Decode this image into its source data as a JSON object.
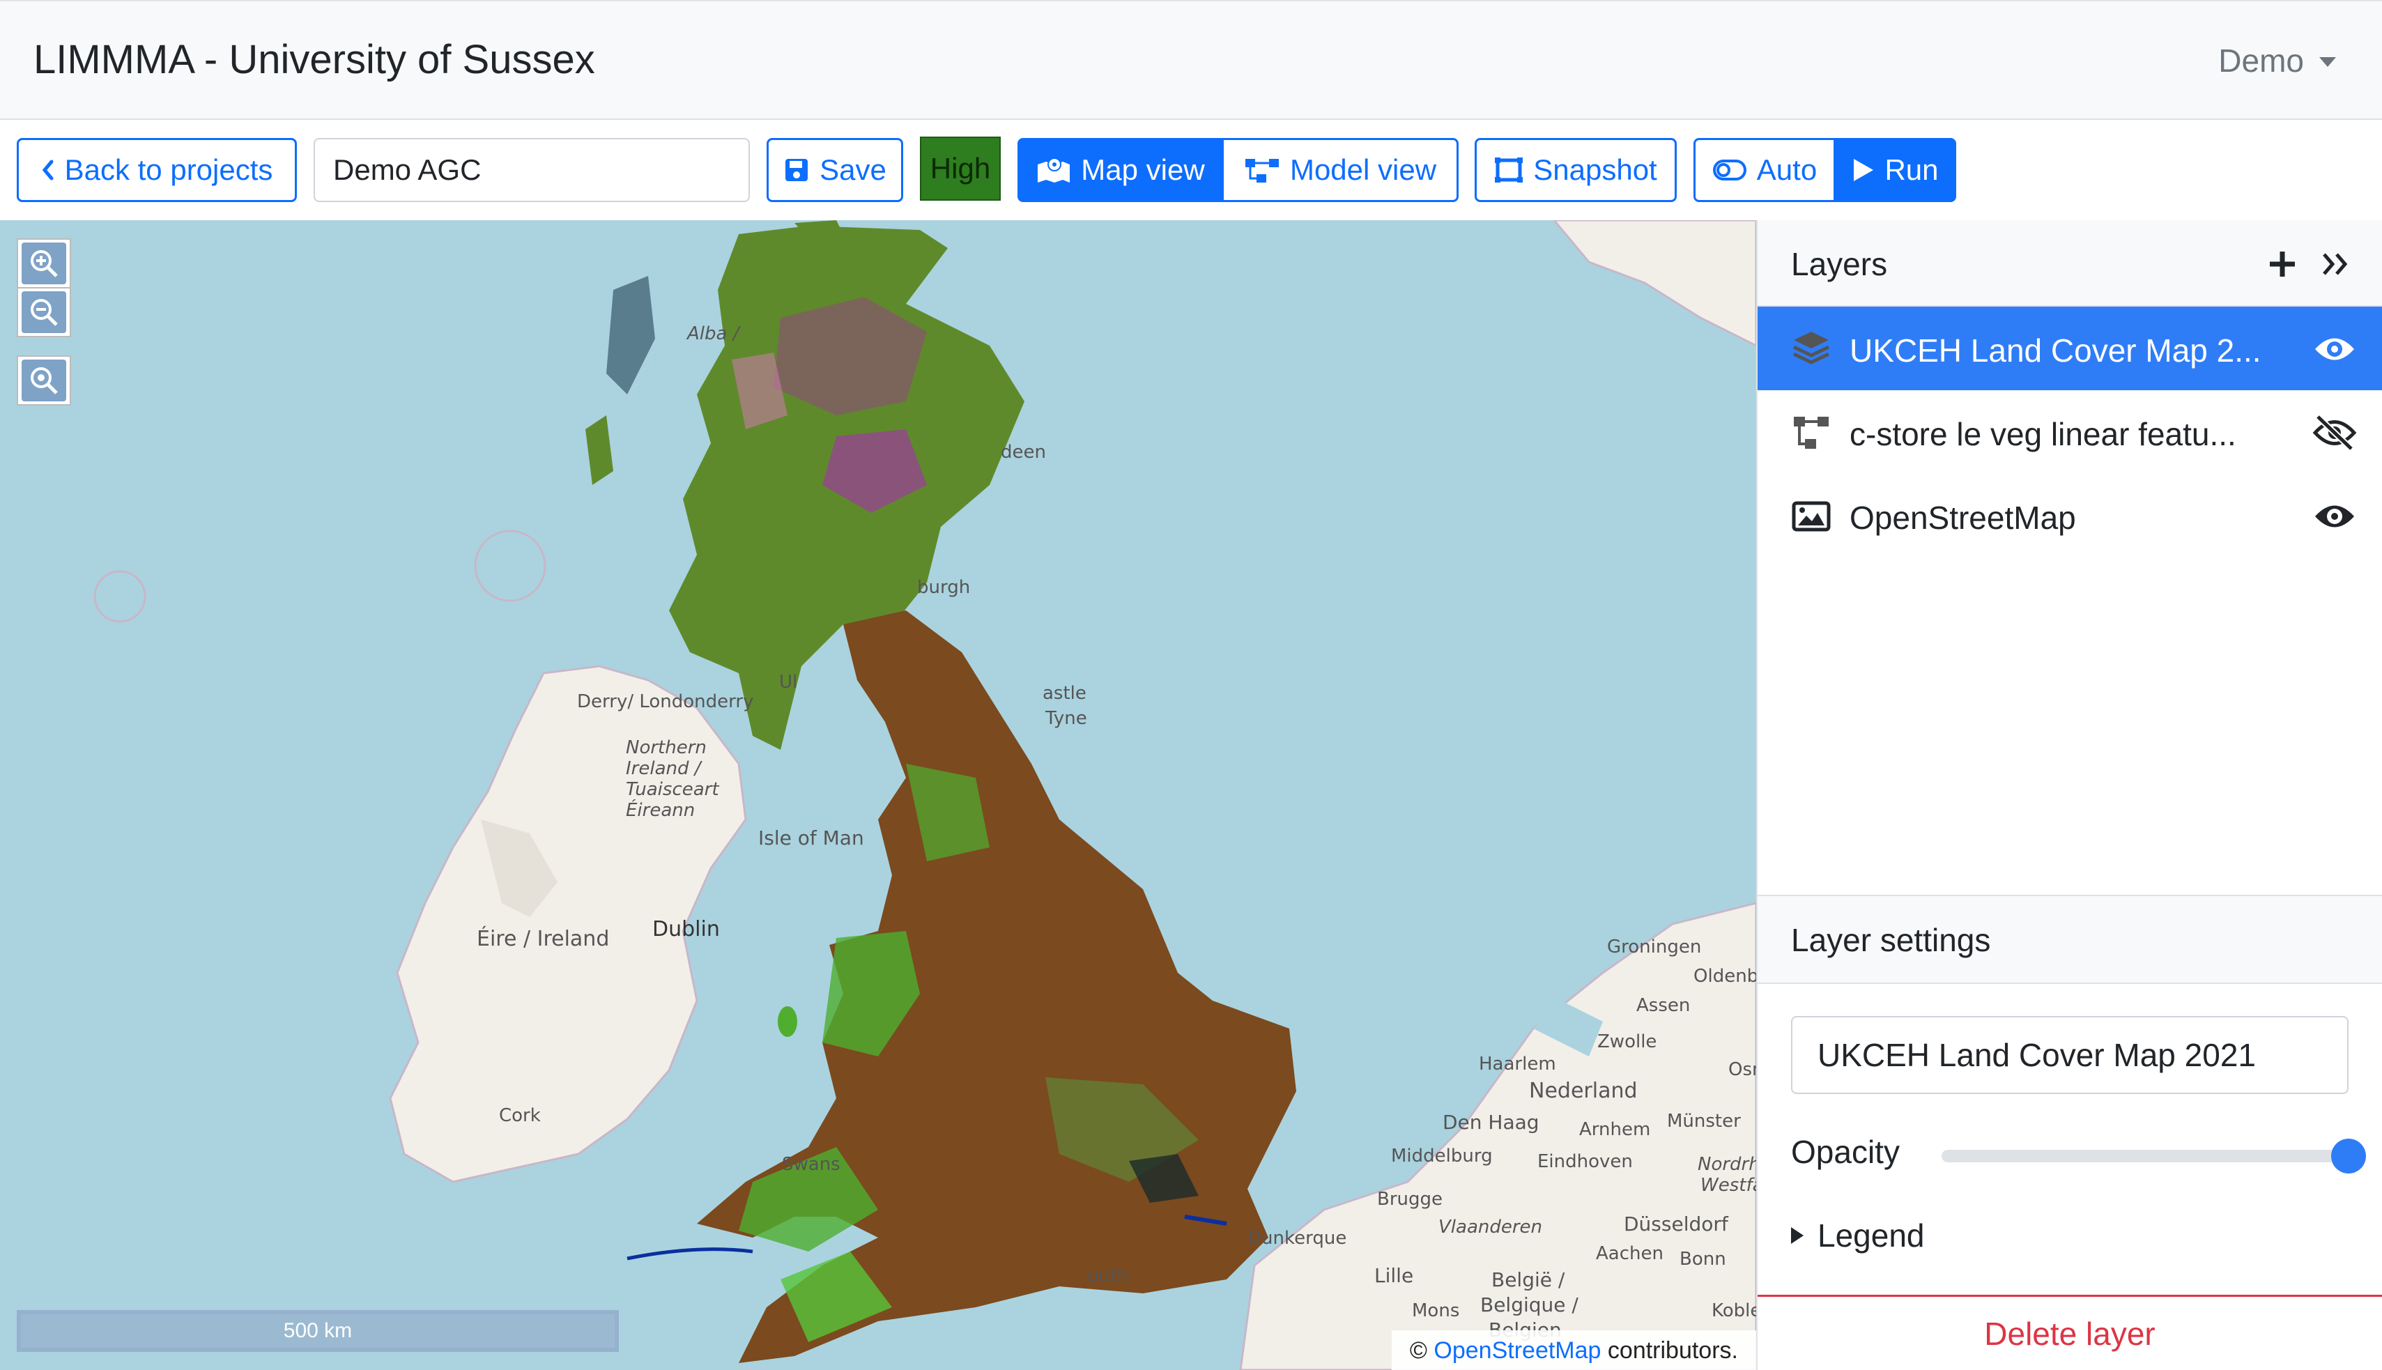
{
  "app": {
    "title": "LIMMMA - University of Sussex",
    "user_menu": "Demo"
  },
  "toolbar": {
    "back_label": "Back to projects",
    "project_name": "Demo AGC",
    "save_label": "Save",
    "quality_badge": "High",
    "map_view_label": "Map view",
    "model_view_label": "Model view",
    "snapshot_label": "Snapshot",
    "auto_label": "Auto",
    "run_label": "Run"
  },
  "map": {
    "scale_label": "500 km",
    "attribution_prefix": "©",
    "attribution_link": "OpenStreetMap",
    "attribution_suffix": "contributors.",
    "labels": {
      "derry": "Derry/ Londonderry",
      "ni": "Northern Ireland / Tuaisceart Éireann",
      "isle_of_man": "Isle of Man",
      "eire": "Éire / Ireland",
      "dublin": "Dublin",
      "cork": "Cork",
      "alba": "Alba /",
      "deen": "deen",
      "burgh": "burgh",
      "astle": "astle",
      "tyne": "Tyne",
      "groningen": "Groningen",
      "oldenbu": "Oldenbu",
      "assen": "Assen",
      "zwolle": "Zwolle",
      "haarlem": "Haarlem",
      "nederland": "Nederland",
      "den_haag": "Den Haag",
      "arnhem": "Arnhem",
      "munster": "Münster",
      "middelburg": "Middelburg",
      "eindhoven": "Eindhoven",
      "nordrhe": "Nordrhe",
      "westfal": "Westfal",
      "brugge": "Brugge",
      "vlaanderen": "Vlaanderen",
      "dusseldorf": "Düsseldorf",
      "dunkerque": "Dunkerque",
      "aachen": "Aachen",
      "bonn": "Bonn",
      "lille": "Lille",
      "belgie": "België /",
      "belgique": "Belgique /",
      "belgien": "Belgien",
      "mons": "Mons",
      "koblen": "Koblen",
      "swans": "Swans",
      "outh": "outh",
      "osn": "Osn",
      "ul": "Ul"
    }
  },
  "layers": {
    "title": "Layers",
    "items": [
      {
        "name": "UKCEH Land Cover Map 2...",
        "icon": "layers-stack-icon",
        "visible": true
      },
      {
        "name": "c-store le veg linear featu...",
        "icon": "model-graph-icon",
        "visible": false
      },
      {
        "name": "OpenStreetMap",
        "icon": "image-tile-icon",
        "visible": true
      }
    ]
  },
  "settings": {
    "title": "Layer settings",
    "layer_name": "UKCEH Land Cover Map 2021",
    "opacity_label": "Opacity",
    "opacity": 1.0,
    "legend_label": "Legend",
    "delete_label": "Delete layer"
  },
  "colors": {
    "primary": "#0d6efd",
    "active_row": "#2f7df6",
    "danger": "#dc3545",
    "badge": "#2e7d1f",
    "sea": "#aad3df"
  }
}
